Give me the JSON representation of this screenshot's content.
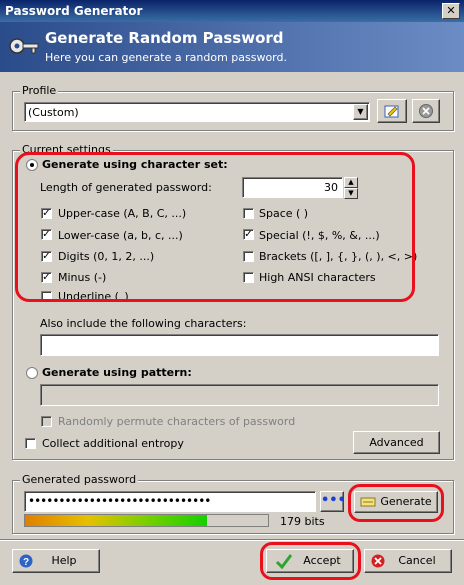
{
  "window": {
    "title": "Password Generator",
    "close_glyph": "✕"
  },
  "banner": {
    "title": "Generate Random Password",
    "subtitle": "Here you can generate a random password."
  },
  "profile": {
    "group_label": "Profile",
    "value": "(Custom)"
  },
  "settings": {
    "group_label": "Current settings",
    "charset_radio_label": "Generate using character set:",
    "length_label": "Length of generated password:",
    "length_value": "30",
    "left_options": [
      {
        "label": "Upper-case (A, B, C, ...)",
        "checked": true
      },
      {
        "label": "Lower-case (a, b, c, ...)",
        "checked": true
      },
      {
        "label": "Digits (0, 1, 2, ...)",
        "checked": true
      },
      {
        "label": "Minus (-)",
        "checked": true
      },
      {
        "label": "Underline (_)",
        "checked": false
      }
    ],
    "right_options": [
      {
        "label": "Space ( )",
        "checked": false
      },
      {
        "label": "Special (!, $, %, &, ...)",
        "checked": true
      },
      {
        "label": "Brackets ([, ], {, }, (, ), <, >)",
        "checked": false
      },
      {
        "label": "High ANSI characters",
        "checked": false
      }
    ],
    "also_include_label": "Also include the following characters:",
    "also_include_value": "",
    "pattern_radio_label": "Generate using pattern:",
    "pattern_value": "",
    "permute_label": "Randomly permute characters of password",
    "entropy_label": "Collect additional entropy",
    "advanced_label": "Advanced"
  },
  "generated": {
    "group_label": "Generated password",
    "value": "••••••••••••••••••••••••••••••",
    "dots_label": "•••",
    "generate_label": "Generate",
    "quality_fraction": 0.75,
    "bits_label": "179 bits"
  },
  "footer": {
    "help_label": "Help",
    "accept_label": "Accept",
    "cancel_label": "Cancel"
  },
  "colors": {
    "accent_red": "#e8101c",
    "check_green": "#2ea52e",
    "dots_blue": "#1a3fd1"
  }
}
